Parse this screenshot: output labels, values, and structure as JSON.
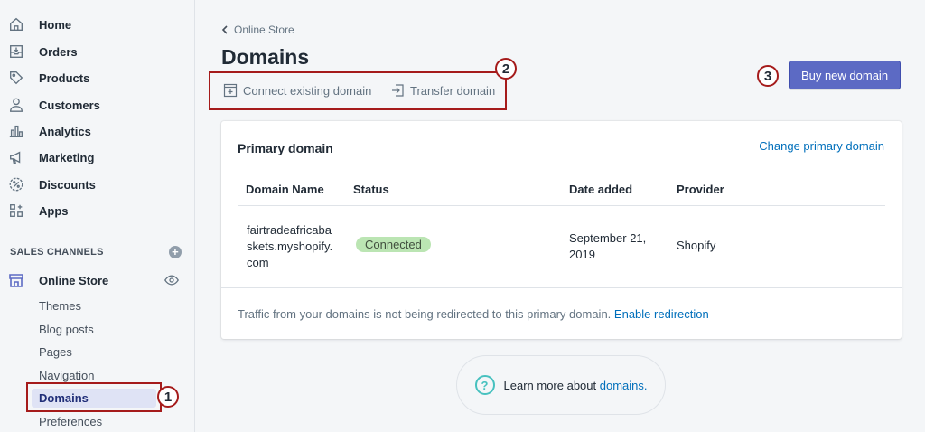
{
  "sidebar": {
    "items": [
      {
        "label": "Home",
        "icon": "home-icon"
      },
      {
        "label": "Orders",
        "icon": "orders-icon"
      },
      {
        "label": "Products",
        "icon": "tag-icon"
      },
      {
        "label": "Customers",
        "icon": "person-icon"
      },
      {
        "label": "Analytics",
        "icon": "bar-chart-icon"
      },
      {
        "label": "Marketing",
        "icon": "megaphone-icon"
      },
      {
        "label": "Discounts",
        "icon": "discount-icon"
      },
      {
        "label": "Apps",
        "icon": "apps-icon"
      }
    ],
    "channels_header": "SALES CHANNELS",
    "online_store": "Online Store",
    "sub_items": [
      {
        "label": "Themes"
      },
      {
        "label": "Blog posts"
      },
      {
        "label": "Pages"
      },
      {
        "label": "Navigation"
      },
      {
        "label": "Domains",
        "active": true
      },
      {
        "label": "Preferences"
      }
    ]
  },
  "main": {
    "breadcrumb": "Online Store",
    "title": "Domains",
    "actions": {
      "connect": "Connect existing domain",
      "transfer": "Transfer domain"
    },
    "buy_button": "Buy new domain",
    "card": {
      "title": "Primary domain",
      "change_link": "Change primary domain",
      "columns": [
        "Domain Name",
        "Status",
        "Date added",
        "Provider"
      ],
      "row": {
        "domain_line1": "fairtradeafricaba",
        "domain_line2": "skets.myshopify.",
        "domain_line3": "com",
        "status": "Connected",
        "date_line1": "September 21,",
        "date_line2": "2019",
        "provider": "Shopify"
      },
      "footer_text": "Traffic from your domains is not being redirected to this primary domain.",
      "footer_link": "Enable redirection"
    },
    "learn_more": {
      "text": "Learn more about",
      "link": "domains."
    }
  },
  "annotations": [
    "1",
    "2",
    "3"
  ],
  "colors": {
    "accent": "#5c6ac4",
    "link": "#006fbb",
    "badge_success": "#bbe5b3",
    "annotation": "#a51b1b"
  }
}
